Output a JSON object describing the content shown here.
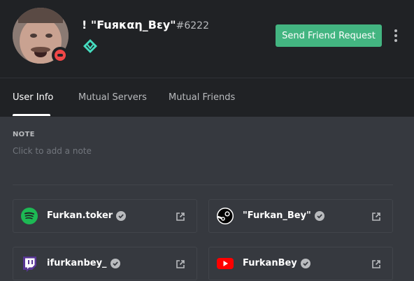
{
  "profile": {
    "username": "! \"Fuяκαη_Bεy\"",
    "discriminator": "#6222",
    "status": "dnd",
    "status_color": "#f04747",
    "badge_icon": "hypesquad-balance-icon"
  },
  "actions": {
    "friend_request_label": "Send Friend Request",
    "friend_request_color": "#43b581",
    "more_icon": "more-vertical-icon"
  },
  "tabs": [
    {
      "label": "User Info",
      "active": true
    },
    {
      "label": "Mutual Servers",
      "active": false
    },
    {
      "label": "Mutual Friends",
      "active": false
    }
  ],
  "note": {
    "label": "NOTE",
    "placeholder": "Click to add a note"
  },
  "connected_accounts": [
    {
      "service": "spotify",
      "icon": "spotify-icon",
      "name": "Furkan.toker",
      "verified": true
    },
    {
      "service": "steam",
      "icon": "steam-icon",
      "name": "\"Furkan_Bey\"",
      "verified": true
    },
    {
      "service": "twitch",
      "icon": "twitch-icon",
      "name": "ifurkanbey_",
      "verified": true
    },
    {
      "service": "youtube",
      "icon": "youtube-icon",
      "name": "FurkanBey",
      "verified": true
    }
  ],
  "colors": {
    "header_bg": "#202225",
    "body_bg": "#36393f",
    "spotify": "#1db954",
    "twitch": "#593695",
    "youtube": "#ff0000"
  }
}
